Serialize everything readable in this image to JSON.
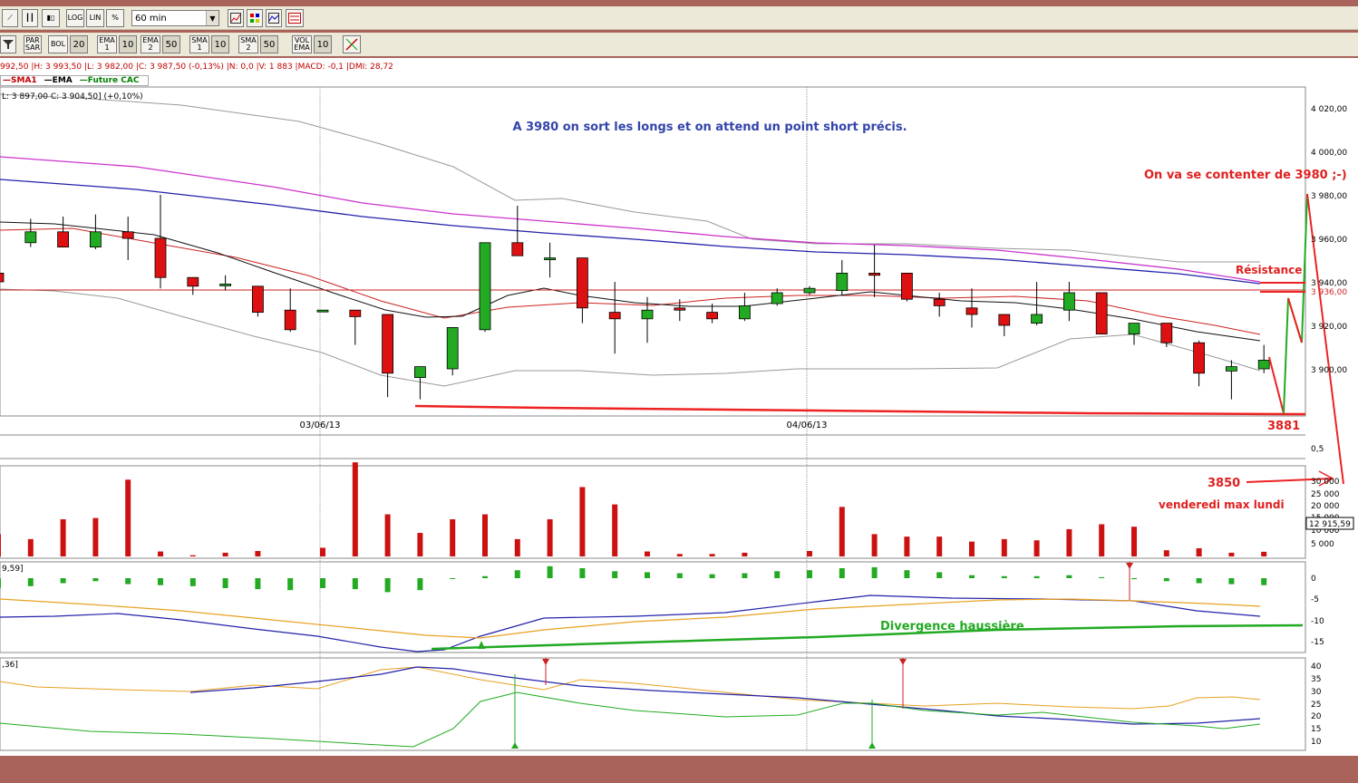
{
  "toolbar1": {
    "buttons": [
      {
        "name": "line-chart-icon",
        "label": "⟋"
      },
      {
        "name": "bar-chart-icon",
        "label": "┃┃"
      },
      {
        "name": "candlestick-icon",
        "label": "▮▯"
      },
      {
        "name": "log-scale-button",
        "label": "LOG"
      },
      {
        "name": "lin-scale-button",
        "label": "LIN"
      },
      {
        "name": "percent-scale-button",
        "label": "%"
      }
    ],
    "period": "60 min"
  },
  "toolbar2": {
    "indicators": [
      {
        "label": "PAR SAR",
        "value": ""
      },
      {
        "label": "BOL",
        "value": "20"
      },
      {
        "label": "EMA 1",
        "value": "10"
      },
      {
        "label": "EMA 2",
        "value": "50"
      },
      {
        "label": "SMA 1",
        "value": "10"
      },
      {
        "label": "SMA 2",
        "value": "50"
      },
      {
        "label": "VOL EMA",
        "value": "10"
      }
    ]
  },
  "info_line": "992,50 |H: 3 993,50 |L: 3 982,00 |C: 3 987,50 (-0,13%) |N: 0,0 |V: 1 883 |MACD: -0,1 |DMI: 28,72",
  "legend": [
    {
      "label": "SMA1",
      "color": "#c00000"
    },
    {
      "label": "EMA",
      "color": "#000000"
    },
    {
      "label": "Future CAC",
      "color": "#008000"
    }
  ],
  "ohlc_line": "L: 3 897,00  C: 3 904,50] (+0,10%)",
  "annotations": {
    "main_note": "A 3980 on sort les longs et on attend un point short précis.",
    "target_note": "On va se contenter de 3980 ;-)",
    "resistance": "Résistance",
    "low_level": "3881",
    "level_3850": "3850",
    "friday_note": "venderedi max lundi",
    "divergence": "Divergence haussière"
  },
  "x_axis": {
    "dates": [
      "03/06/13",
      "04/06/13"
    ]
  },
  "price_axis": {
    "ticks": [
      "4 020,00",
      "4 000,00",
      "3 980,00",
      "3 960,00",
      "3 940,00",
      "3 920,00",
      "3 900,00"
    ],
    "resistance_label": "3 936,00"
  },
  "osc_axis": {
    "ticks": [
      "0,5"
    ]
  },
  "volume_axis": {
    "ticks": [
      "30 000",
      "25 000",
      "20 000",
      "15 000",
      "10 000",
      "5 000"
    ],
    "last_label": "12 915,59"
  },
  "macd_panel": {
    "label": "9,59]",
    "ticks": [
      "0",
      "-5",
      "-10",
      "-15"
    ]
  },
  "dmi_panel": {
    "label": ",36]",
    "ticks": [
      "40",
      "35",
      "30",
      "25",
      "20",
      "15",
      "10"
    ]
  },
  "colors": {
    "frame": "#a9635b",
    "bull": "#22aa22",
    "bear": "#dd1111",
    "note_blue": "#3344aa",
    "note_red": "#e02020",
    "note_green": "#22aa22"
  },
  "chart_data": {
    "type": "candlestick",
    "price_ylim": [
      3880,
      4030
    ],
    "candles": [
      {
        "o": 3944,
        "h": 3952,
        "l": 3937,
        "c": 3940
      },
      {
        "o": 3958,
        "h": 3969,
        "l": 3956,
        "c": 3963
      },
      {
        "o": 3963,
        "h": 3970,
        "l": 3956,
        "c": 3956
      },
      {
        "o": 3956,
        "h": 3971,
        "l": 3955,
        "c": 3963
      },
      {
        "o": 3963,
        "h": 3970,
        "l": 3950,
        "c": 3960
      },
      {
        "o": 3960,
        "h": 3980,
        "l": 3937,
        "c": 3942
      },
      {
        "o": 3942,
        "h": 3942,
        "l": 3934,
        "c": 3938
      },
      {
        "o": 3939,
        "h": 3943,
        "l": 3936,
        "c": 3939
      },
      {
        "o": 3938,
        "h": 3938,
        "l": 3924,
        "c": 3926
      },
      {
        "o": 3927,
        "h": 3937,
        "l": 3917,
        "c": 3918
      },
      {
        "o": 3927,
        "h": 3927,
        "l": 3927,
        "c": 3927
      },
      {
        "o": 3927,
        "h": 3927,
        "l": 3911,
        "c": 3924
      },
      {
        "o": 3925,
        "h": 3925,
        "l": 3887,
        "c": 3898
      },
      {
        "o": 3896,
        "h": 3901,
        "l": 3886,
        "c": 3901
      },
      {
        "o": 3900,
        "h": 3919,
        "l": 3897,
        "c": 3919
      },
      {
        "o": 3918,
        "h": 3958,
        "l": 3917,
        "c": 3958
      },
      {
        "o": 3958,
        "h": 3975,
        "l": 3952,
        "c": 3952
      },
      {
        "o": 3951,
        "h": 3958,
        "l": 3942,
        "c": 3951
      },
      {
        "o": 3951,
        "h": 3951,
        "l": 3921,
        "c": 3928
      },
      {
        "o": 3926,
        "h": 3940,
        "l": 3907,
        "c": 3923
      },
      {
        "o": 3923,
        "h": 3933,
        "l": 3912,
        "c": 3927
      },
      {
        "o": 3928,
        "h": 3932,
        "l": 3922,
        "c": 3927
      },
      {
        "o": 3926,
        "h": 3930,
        "l": 3921,
        "c": 3923
      },
      {
        "o": 3923,
        "h": 3935,
        "l": 3922,
        "c": 3929
      },
      {
        "o": 3930,
        "h": 3937,
        "l": 3929,
        "c": 3935
      },
      {
        "o": 3935,
        "h": 3938,
        "l": 3934,
        "c": 3937
      },
      {
        "o": 3936,
        "h": 3950,
        "l": 3934,
        "c": 3944
      },
      {
        "o": 3944,
        "h": 3957,
        "l": 3933,
        "c": 3943
      },
      {
        "o": 3944,
        "h": 3944,
        "l": 3931,
        "c": 3932
      },
      {
        "o": 3932,
        "h": 3935,
        "l": 3924,
        "c": 3929
      },
      {
        "o": 3928,
        "h": 3937,
        "l": 3919,
        "c": 3925
      },
      {
        "o": 3925,
        "h": 3925,
        "l": 3915,
        "c": 3920
      },
      {
        "o": 3921,
        "h": 3940,
        "l": 3920,
        "c": 3925
      },
      {
        "o": 3927,
        "h": 3940,
        "l": 3922,
        "c": 3935
      },
      {
        "o": 3935,
        "h": 3935,
        "l": 3916,
        "c": 3916
      },
      {
        "o": 3916,
        "h": 3921,
        "l": 3911,
        "c": 3921
      },
      {
        "o": 3921,
        "h": 3921,
        "l": 3910,
        "c": 3912
      },
      {
        "o": 3912,
        "h": 3913,
        "l": 3892,
        "c": 3898
      },
      {
        "o": 3899,
        "h": 3904,
        "l": 3886,
        "c": 3901
      },
      {
        "o": 3900,
        "h": 3911,
        "l": 3898,
        "c": 3904
      }
    ],
    "volume_ylim": [
      0,
      40000
    ],
    "volumes": [
      9000,
      7000,
      15000,
      15500,
      31000,
      2000,
      500,
      1500,
      2200,
      0,
      3500,
      38000,
      17000,
      9500,
      15000,
      17000,
      7000,
      15000,
      28000,
      21000,
      2000,
      1000,
      1000,
      1500,
      0,
      2200,
      20000,
      9000,
      8000,
      8000,
      6000,
      7000,
      6500,
      11000,
      13000,
      12000,
      2500,
      3300,
      1500,
      1883
    ]
  }
}
